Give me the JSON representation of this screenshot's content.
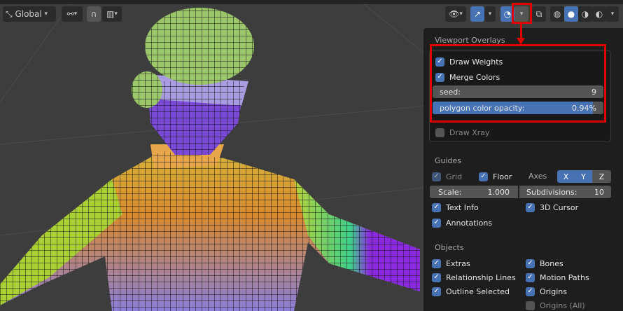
{
  "toolbar": {
    "orientation": "Global"
  },
  "overlay_panel": {
    "title": "Viewport Overlays",
    "draw_weights": {
      "label": "Draw Weights",
      "checked": true
    },
    "merge_colors": {
      "label": "Merge Colors",
      "checked": true
    },
    "seed": {
      "label": "seed:",
      "value": "9"
    },
    "opacity": {
      "label": "polygon color opacity:",
      "value": "0.94%",
      "fill_fraction": 0.94
    },
    "draw_xray": {
      "label": "Draw Xray",
      "checked": false
    },
    "guides": {
      "title": "Guides",
      "grid": "Grid",
      "floor": "Floor",
      "axes": "Axes",
      "x": "X",
      "y": "Y",
      "z": "Z",
      "scale_label": "Scale:",
      "scale_value": "1.000",
      "subdiv_label": "Subdivisions:",
      "subdiv_value": "10",
      "text_info": "Text Info",
      "cursor": "3D Cursor",
      "annotations": "Annotations"
    },
    "objects": {
      "title": "Objects",
      "extras": "Extras",
      "bones": "Bones",
      "relationship": "Relationship Lines",
      "motion": "Motion Paths",
      "outline": "Outline Selected",
      "origins": "Origins",
      "origins_all": "Origins (All)"
    }
  },
  "colors": {
    "accent": "#4772b3",
    "highlight": "#e00000"
  }
}
